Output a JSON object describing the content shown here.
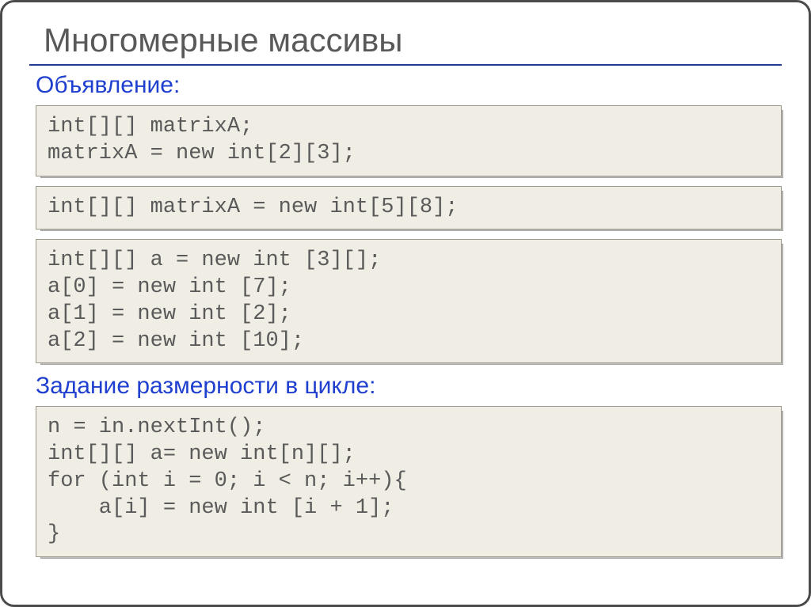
{
  "title": "Многомерные массивы",
  "section1": "Объявление:",
  "code1": "int[][] matrixA;\nmatrixA = new int[2][3];",
  "code2": "int[][] matrixA = new int[5][8];",
  "code3": "int[][] a = new int [3][];\na[0] = new int [7];\na[1] = new int [2];\na[2] = new int [10];",
  "section2": "Задание размерности в цикле:",
  "code4": "n = in.nextInt();\nint[][] a= new int[n][];\nfor (int i = 0; i < n; i++){\n    a[i] = new int [i + 1];\n}"
}
